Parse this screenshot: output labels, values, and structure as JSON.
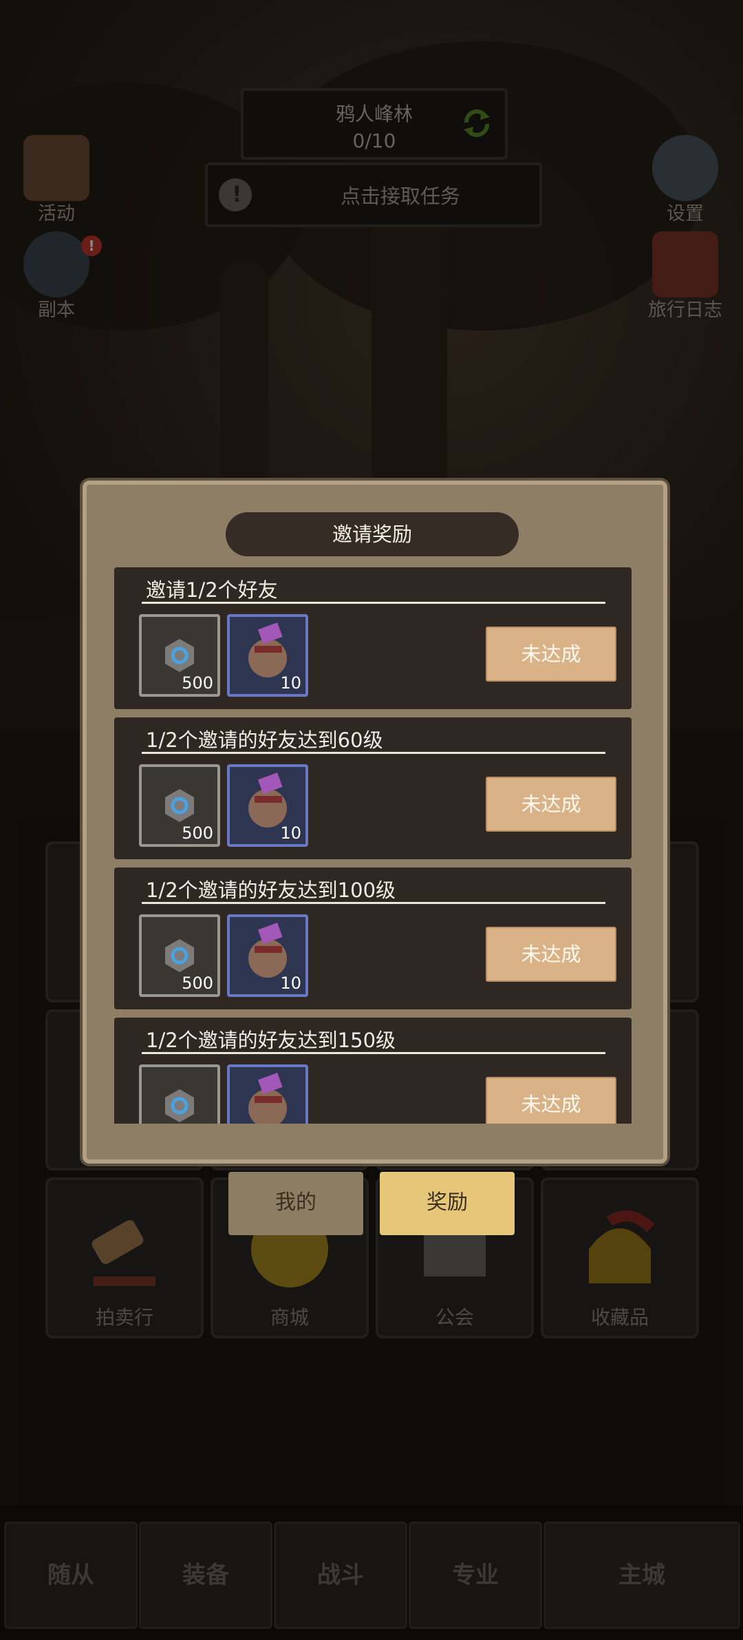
{
  "hud": {
    "quest_name": "鸦人峰林",
    "quest_progress": "0/10",
    "task_prompt": "点击接取任务"
  },
  "side_left": [
    {
      "label": "活动",
      "icon": "scroll-icon"
    },
    {
      "label": "副本",
      "icon": "portal-icon",
      "badge": "!"
    }
  ],
  "side_right": [
    {
      "label": "设置",
      "icon": "gear-icon"
    },
    {
      "label": "旅行日志",
      "icon": "book-icon"
    }
  ],
  "modal": {
    "title": "邀请奖励",
    "rows": [
      {
        "title": "邀请1/2个好友",
        "rewards": [
          {
            "icon": "gear-stone-icon",
            "qty": "500"
          },
          {
            "icon": "hero-card-icon",
            "qty": "10"
          }
        ],
        "status": "未达成"
      },
      {
        "title": "1/2个邀请的好友达到60级",
        "rewards": [
          {
            "icon": "gear-stone-icon",
            "qty": "500"
          },
          {
            "icon": "hero-card-icon",
            "qty": "10"
          }
        ],
        "status": "未达成"
      },
      {
        "title": "1/2个邀请的好友达到100级",
        "rewards": [
          {
            "icon": "gear-stone-icon",
            "qty": "500"
          },
          {
            "icon": "hero-card-icon",
            "qty": "10"
          }
        ],
        "status": "未达成"
      },
      {
        "title": "1/2个邀请的好友达到150级",
        "rewards": [
          {
            "icon": "gear-stone-icon",
            "qty": ""
          },
          {
            "icon": "hero-card-icon",
            "qty": ""
          }
        ],
        "status": "未达成"
      }
    ]
  },
  "tabs": {
    "mine": "我的",
    "reward": "奖励"
  },
  "grid_tiles": [
    {
      "label": "拍卖行",
      "icon": "gavel-icon"
    },
    {
      "label": "商城",
      "icon": "coin-icon"
    },
    {
      "label": "公会",
      "icon": "guild-icon"
    },
    {
      "label": "收藏品",
      "icon": "helmet-icon"
    }
  ],
  "nav": [
    {
      "label": "随从"
    },
    {
      "label": "装备"
    },
    {
      "label": "战斗"
    },
    {
      "label": "专业"
    },
    {
      "label": "主城"
    }
  ],
  "colors": {
    "modal_bg": "#8e7e66",
    "row_bg": "#2e2722",
    "claim_button": "#d9b387",
    "reward_tab_active": "#e6c77a"
  }
}
